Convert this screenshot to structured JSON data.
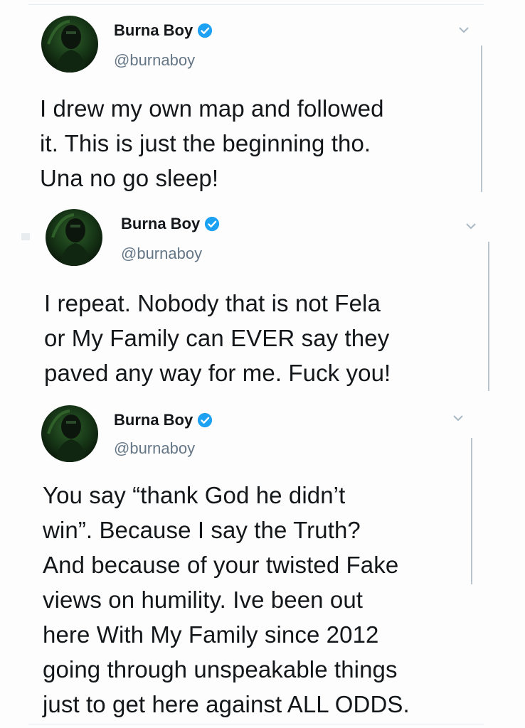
{
  "tweets": [
    {
      "display_name": "Burna Boy",
      "handle": "@burnaboy",
      "text": "I drew my own map and followed\nit. This is just the beginning tho.\nUna no go sleep!",
      "verified": true
    },
    {
      "display_name": "Burna Boy",
      "handle": "@burnaboy",
      "text": "I repeat. Nobody that is not Fela\nor My Family can EVER say they\npaved any way for me. Fuck you!",
      "verified": true
    },
    {
      "display_name": "Burna Boy",
      "handle": "@burnaboy",
      "text": "You say “thank God he didn’t\nwin”.  Because I say the Truth?\nAnd because of your twisted Fake\nviews on humility.  Ive been out\nhere With My Family since 2012\ngoing through unspeakable things\njust to get here against ALL ODDS.",
      "verified": true
    }
  ],
  "icons": {
    "verified": "verified-badge-icon",
    "caret": "chevron-down-icon",
    "avatar": "profile-avatar"
  },
  "colors": {
    "verified_blue": "#1da1f2",
    "handle_gray": "#657786",
    "text": "#14171a"
  }
}
